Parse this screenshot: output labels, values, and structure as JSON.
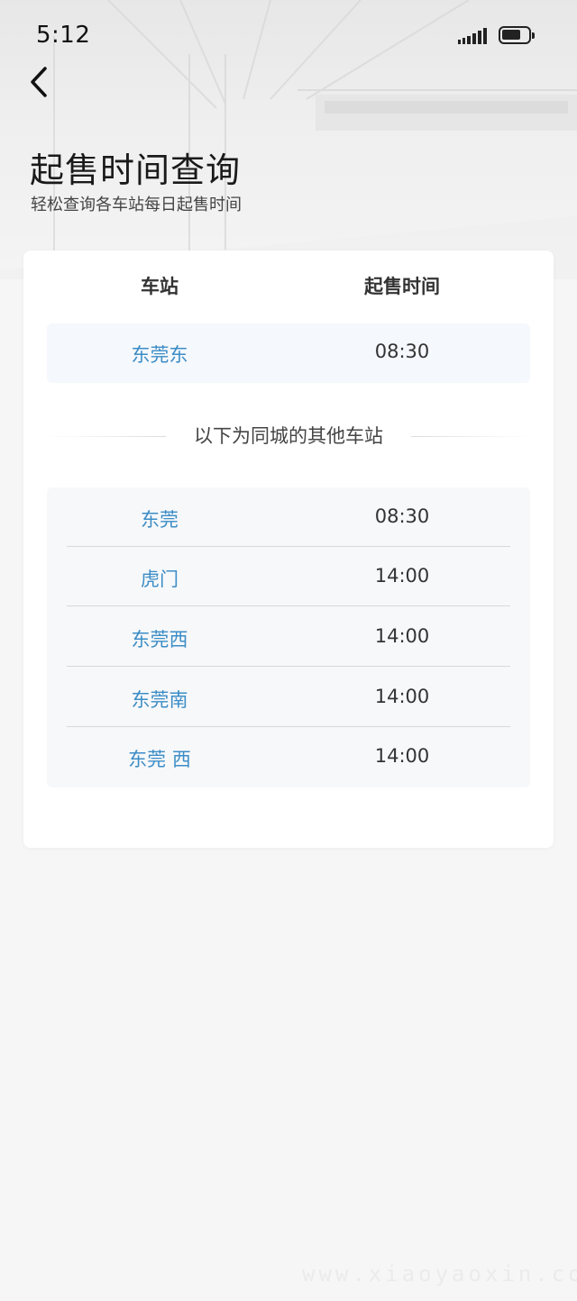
{
  "status_bar": {
    "time": "5:12",
    "battery_level": 0.75
  },
  "header": {
    "title": "起售时间查询",
    "subtitle": "轻松查询各车站每日起售时间"
  },
  "table": {
    "columns": [
      "车站",
      "起售时间"
    ],
    "main_station": {
      "name": "东莞东",
      "time": "08:30"
    },
    "divider_text": "以下为同城的其他车站",
    "other_stations": [
      {
        "name": "东莞",
        "time": "08:30"
      },
      {
        "name": "虎门",
        "time": "14:00"
      },
      {
        "name": "东莞西",
        "time": "14:00"
      },
      {
        "name": "东莞南",
        "time": "14:00"
      },
      {
        "name": "东莞 西",
        "time": "14:00"
      }
    ]
  },
  "watermark": "www.xiaoyaoxin.com",
  "colors": {
    "station_link": "#3c8dc6",
    "background": "#f6f6f6"
  },
  "icons": [
    "back-arrow-icon",
    "signal-icon",
    "battery-icon"
  ]
}
